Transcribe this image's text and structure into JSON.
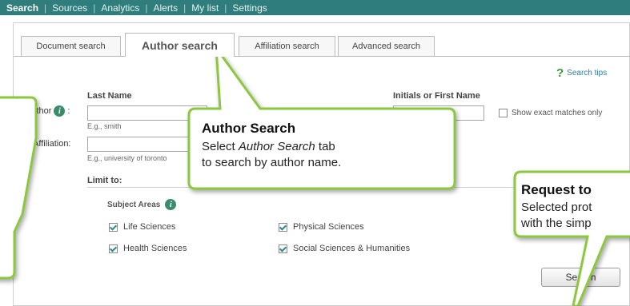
{
  "topnav": {
    "items": [
      "Search",
      "Sources",
      "Analytics",
      "Alerts",
      "My list",
      "Settings"
    ],
    "separator": "|",
    "active": "Search"
  },
  "tabs": [
    "Document search",
    "Author search",
    "Affiliation search",
    "Advanced search"
  ],
  "active_tab": "Author search",
  "search_tips": "Search tips",
  "author_form": {
    "author_label": "Author",
    "colon": ":",
    "last_name_label": "Last Name",
    "last_name_value": "",
    "last_name_hint": "E.g., smith",
    "initials_label": "Initials or First Name",
    "initials_value": "",
    "affiliation_label": "Affiliation:",
    "affiliation_value": "",
    "affiliation_hint": "E.g., university of toronto",
    "exact_matches_label": "Show exact matches only",
    "exact_matches_checked": false
  },
  "limit": {
    "label": "Limit to:",
    "subject_areas_label": "Subject Areas",
    "areas": [
      {
        "label": "Life Sciences",
        "checked": true
      },
      {
        "label": "Physical Sciences",
        "checked": true
      },
      {
        "label": "Health Sciences",
        "checked": true
      },
      {
        "label": "Social Sciences & Humanities",
        "checked": true
      }
    ]
  },
  "search_button": "Search",
  "callout_author": {
    "title": "Author Search",
    "text_line1_pre": "Select ",
    "text_line1_em": "Author Search",
    "text_line1_post": " tab",
    "text_line2": "to search by author name."
  },
  "callout_request": {
    "title": "Request to",
    "line1": "Selected prot",
    "line2": "with the simp"
  },
  "colors": {
    "nav_bg": "#2f7d7c",
    "callout_border": "#8dc63f",
    "callout_fill": "#ffffff",
    "link": "#2a7ea3",
    "info_icon": "#3a8c6d"
  }
}
